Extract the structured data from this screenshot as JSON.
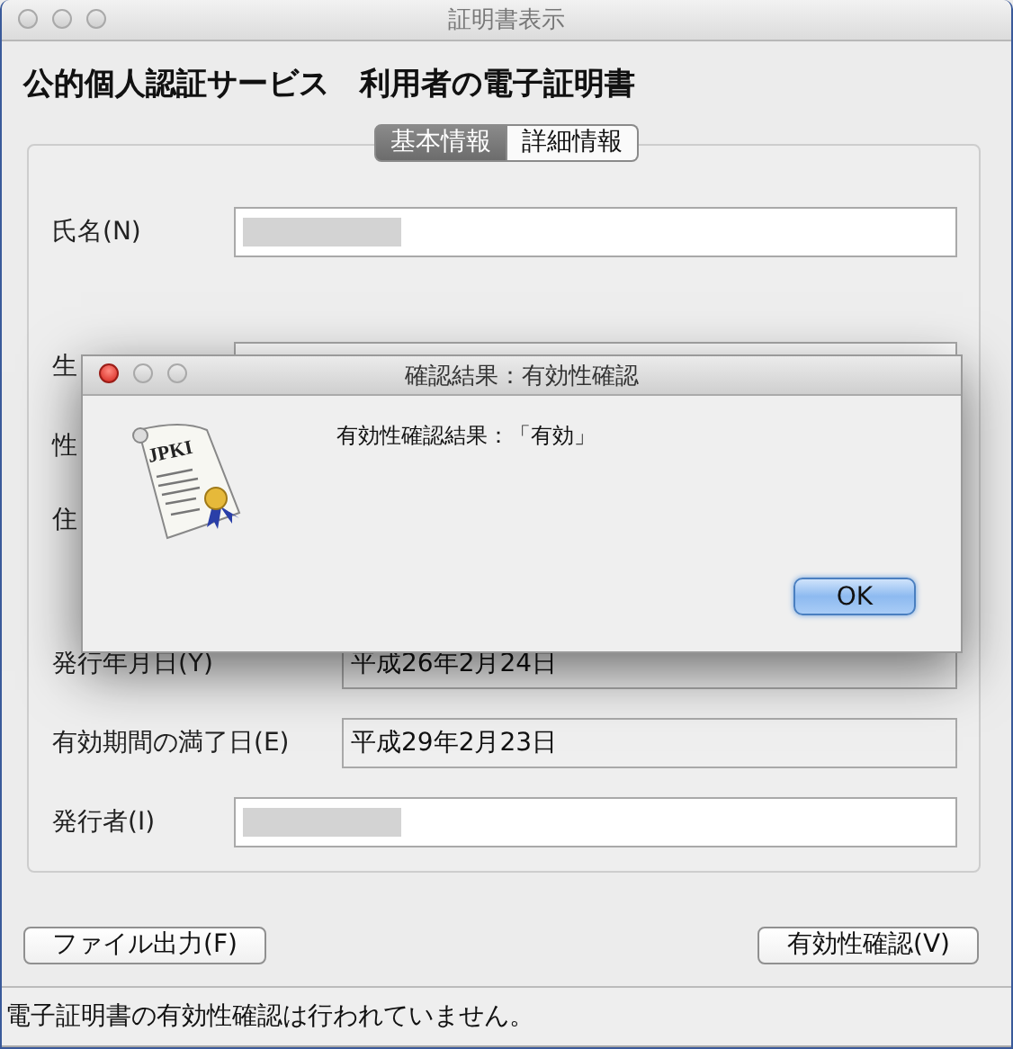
{
  "window": {
    "title": "証明書表示"
  },
  "heading": "公的個人認証サービス　利用者の電子証明書",
  "tabs": [
    {
      "label": "基本情報",
      "selected": true
    },
    {
      "label": "詳細情報",
      "selected": false
    }
  ],
  "fields": [
    {
      "label": "氏名(N)",
      "kind": "wide",
      "redacted": true
    },
    {
      "label": "生",
      "kind": "wide"
    },
    {
      "label": "性",
      "kind": "label_only"
    },
    {
      "label": "住",
      "kind": "label_tall"
    },
    {
      "label": "発行年月日(Y)",
      "kind": "short",
      "value": "平成26年2月24日",
      "redacted": false
    },
    {
      "label": "有効期間の満了日(E)",
      "kind": "short",
      "value": "平成29年2月23日",
      "redacted": false
    },
    {
      "label": "発行者(I)",
      "kind": "wide",
      "redacted": true
    }
  ],
  "buttons": [
    {
      "label": "ファイル出力(F)"
    },
    {
      "label": "有効性確認(V)"
    }
  ],
  "status_bar": "電子証明書の有効性確認は行われていません。",
  "dialog": {
    "title": "確認結果：有効性確認",
    "icon_text": "JPKI",
    "message": "有効性確認結果：「有効」",
    "button": "OK"
  }
}
